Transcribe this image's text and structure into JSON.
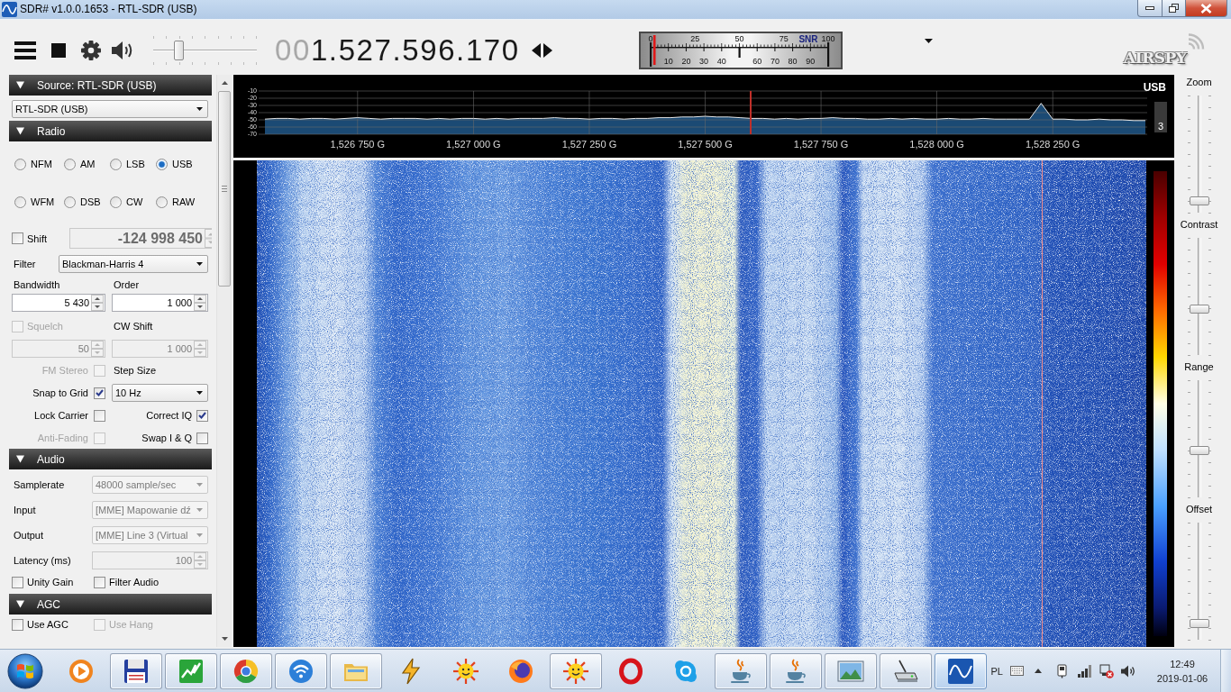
{
  "window": {
    "title": "SDR# v1.0.0.1653 - RTL-SDR (USB)"
  },
  "toolbar": {
    "volume": {
      "level": 0.25
    },
    "frequency": {
      "leading": "00",
      "value": "1.527.596.170"
    },
    "snr_meter": {
      "label": "SNR",
      "top_labels": [
        "0",
        "25",
        "50",
        "75",
        "100"
      ],
      "bottom_labels": [
        "10",
        "20",
        "30",
        "40",
        "60",
        "70",
        "80",
        "90"
      ],
      "level": 0.02
    },
    "logo": "AIRSPY"
  },
  "source": {
    "title": "Source: RTL-SDR (USB)",
    "expanded": true,
    "device": "RTL-SDR (USB)"
  },
  "radio": {
    "title": "Radio",
    "expanded": true,
    "modes": [
      {
        "label": "NFM",
        "selected": false
      },
      {
        "label": "AM",
        "selected": false
      },
      {
        "label": "LSB",
        "selected": false
      },
      {
        "label": "USB",
        "selected": true
      },
      {
        "label": "WFM",
        "selected": false
      },
      {
        "label": "DSB",
        "selected": false
      },
      {
        "label": "CW",
        "selected": false
      },
      {
        "label": "RAW",
        "selected": false
      }
    ],
    "shift": {
      "label": "Shift",
      "checked": false,
      "value": "-124 998 450"
    },
    "filter": {
      "label": "Filter",
      "value": "Blackman-Harris 4"
    },
    "bandwidth": {
      "label": "Bandwidth",
      "value": "5 430"
    },
    "order": {
      "label": "Order",
      "value": "1 000"
    },
    "squelch": {
      "label": "Squelch",
      "checked": false,
      "disabled": true,
      "value": "50"
    },
    "cw_shift": {
      "label": "CW Shift",
      "value": "1 000",
      "disabled": true
    },
    "options": [
      {
        "kind": "check",
        "label": "FM Stereo",
        "checked": false,
        "disabled": true
      },
      {
        "kind": "label",
        "label": "Step Size"
      },
      {
        "kind": "check",
        "label": "Snap to Grid",
        "checked": true,
        "disabled": false
      },
      {
        "kind": "select",
        "value": "10 Hz"
      },
      {
        "kind": "check",
        "label": "Lock Carrier",
        "checked": false,
        "disabled": false
      },
      {
        "kind": "check",
        "label": "Correct IQ",
        "checked": true,
        "disabled": false
      },
      {
        "kind": "check",
        "label": "Anti-Fading",
        "checked": false,
        "disabled": true
      },
      {
        "kind": "check",
        "label": "Swap I & Q",
        "checked": false,
        "disabled": false
      }
    ]
  },
  "audio": {
    "title": "Audio",
    "expanded": true,
    "settings": [
      {
        "kind": "select",
        "label": "Samplerate",
        "value": "48000 sample/sec",
        "disabled": true
      },
      {
        "kind": "select",
        "label": "Input",
        "value": "[MME] Mapowanie dź",
        "disabled": true
      },
      {
        "kind": "select",
        "label": "Output",
        "value": "[MME] Line 3 (Virtual",
        "disabled": true
      },
      {
        "kind": "number",
        "label": "Latency (ms)",
        "value": "100",
        "disabled": true
      }
    ],
    "checks": [
      {
        "label": "Unity Gain",
        "checked": false,
        "disabled": false
      },
      {
        "label": "Filter Audio",
        "checked": false,
        "disabled": false
      }
    ]
  },
  "agc": {
    "title": "AGC",
    "expanded": true,
    "checks": [
      {
        "label": "Use AGC",
        "checked": false,
        "disabled": false
      },
      {
        "label": "Use Hang",
        "checked": false,
        "disabled": true
      }
    ]
  },
  "spectrum": {
    "mode": "USB",
    "badge": "3",
    "chart_data": {
      "type": "line",
      "categories": [
        null,
        null,
        null,
        null,
        null,
        null,
        null,
        null,
        "1,526 750 G",
        null,
        null,
        null,
        null,
        null,
        null,
        null,
        null,
        null,
        "1,527 000 G",
        null,
        null,
        null,
        null,
        null,
        null,
        null,
        null,
        null,
        "1,527 250 G",
        null,
        null,
        null,
        null,
        null,
        null,
        null,
        null,
        null,
        "1,527 500 G",
        null,
        null,
        null,
        null,
        null,
        null,
        null,
        null,
        null,
        "1,527 750 G",
        null,
        null,
        null,
        null,
        null,
        null,
        null,
        null,
        null,
        "1,528 000 G",
        null,
        null,
        null,
        null,
        null,
        null,
        null,
        null,
        null,
        "1,528 250 G",
        null,
        null,
        null,
        null,
        null,
        null,
        null,
        null
      ],
      "series": [
        {
          "color": "#e6e6e6",
          "values": [
            -49,
            -48,
            -48,
            -49,
            -48,
            -48,
            -49,
            -48,
            -47,
            -48,
            -49,
            -48,
            -48,
            -48,
            -49,
            -48,
            -49,
            -48,
            -48,
            -49,
            -48,
            -49,
            -48,
            -48,
            -48,
            -47,
            -48,
            -48,
            -49,
            -48,
            -48,
            -49,
            -48,
            -48,
            -47,
            -47,
            -46,
            -46,
            -45,
            -46,
            -46,
            -47,
            -48,
            -48,
            -49,
            -48,
            -49,
            -48,
            -48,
            -47,
            -48,
            -48,
            -49,
            -49,
            -48,
            -49,
            -48,
            -49,
            -49,
            -48,
            -49,
            -49,
            -48,
            -49,
            -49,
            -49,
            -49,
            -27,
            -49,
            -49,
            -50,
            -50,
            -49,
            -50,
            -50,
            -51,
            -51
          ]
        }
      ],
      "ylim": [
        -70,
        -10
      ],
      "yticks": [
        -10,
        -20,
        -30,
        -40,
        -50,
        -60,
        -70
      ]
    }
  },
  "view_sliders": [
    {
      "label": "Zoom",
      "level": 0.1
    },
    {
      "label": "Contrast",
      "level": 0.39
    },
    {
      "label": "Range",
      "level": 0.4
    },
    {
      "label": "Offset",
      "level": 0.14
    }
  ],
  "taskbar": {
    "items": [
      {
        "kind": "media",
        "running": false,
        "selected": false
      },
      {
        "kind": "floppy",
        "running": true,
        "selected": false
      },
      {
        "kind": "chart",
        "running": true,
        "selected": false
      },
      {
        "kind": "segmented_circle",
        "running": true,
        "selected": false
      },
      {
        "kind": "wifi",
        "running": true,
        "selected": false
      },
      {
        "kind": "folder",
        "running": true,
        "selected": false
      },
      {
        "kind": "bolt",
        "running": false,
        "selected": false
      },
      {
        "kind": "sun",
        "running": false,
        "selected": false
      },
      {
        "kind": "circles",
        "running": false,
        "selected": false
      },
      {
        "kind": "sun",
        "running": true,
        "selected": false
      },
      {
        "kind": "ring",
        "running": false,
        "selected": false
      },
      {
        "kind": "blob",
        "running": false,
        "selected": false
      },
      {
        "kind": "cup",
        "running": true,
        "selected": false
      },
      {
        "kind": "cup",
        "running": true,
        "selected": false
      },
      {
        "kind": "picture",
        "running": true,
        "selected": false
      },
      {
        "kind": "device",
        "running": true,
        "selected": false
      },
      {
        "kind": "wave",
        "running": true,
        "selected": true
      }
    ],
    "language": "PL",
    "time": "12:49",
    "date": "2019-01-06"
  }
}
